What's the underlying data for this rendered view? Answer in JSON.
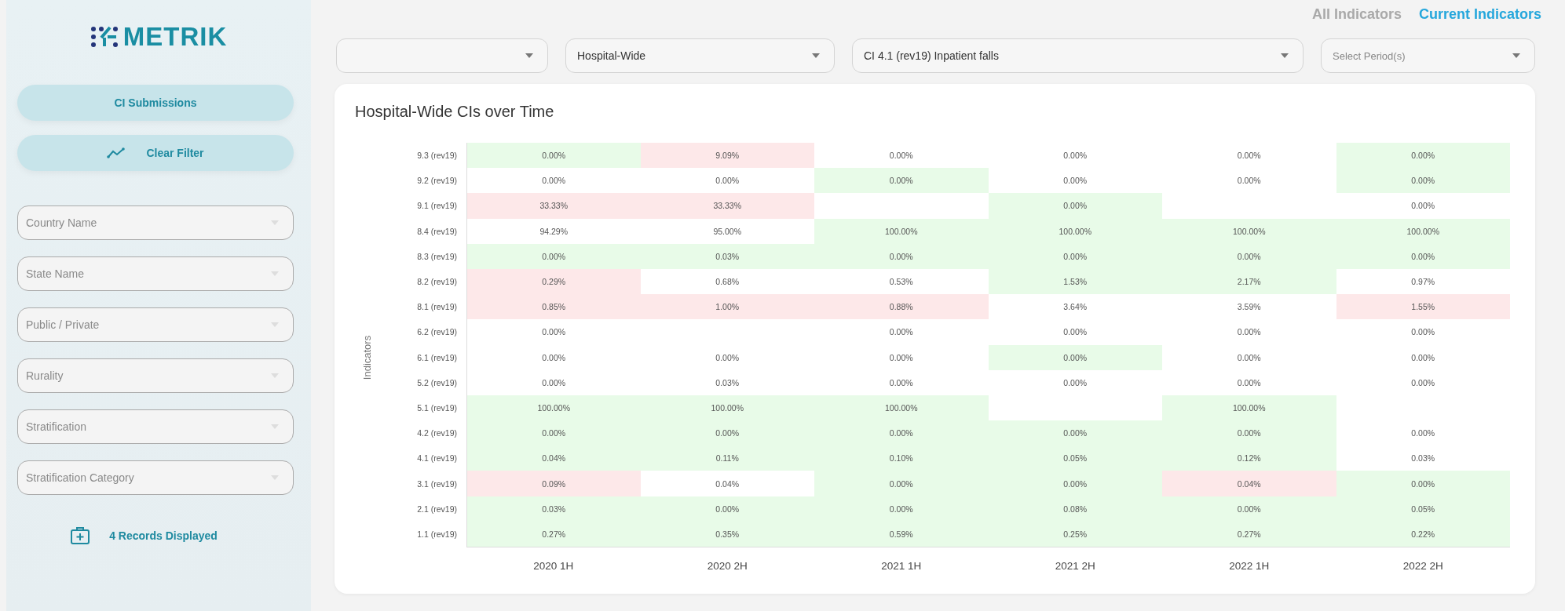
{
  "sidebar": {
    "logo": "METRIK",
    "buttons": [
      {
        "label": "CI Submissions",
        "kind": "plain"
      },
      {
        "label": "Clear Filter",
        "kind": "chart"
      }
    ],
    "filters": [
      {
        "placeholder": "Country Name"
      },
      {
        "placeholder": "State Name"
      },
      {
        "placeholder": "Public / Private"
      },
      {
        "placeholder": "Rurality"
      },
      {
        "placeholder": "Stratification"
      },
      {
        "placeholder": "Stratification Category"
      }
    ],
    "records": "4 Records Displayed"
  },
  "view_tabs": [
    {
      "label": "All Indicators",
      "selected": false
    },
    {
      "label": "Current Indicators",
      "selected": true
    }
  ],
  "dropdowns": [
    {
      "kind": "dropdown"
    },
    {
      "kind": "dropdown",
      "value": "Hospital-Wide"
    },
    {
      "kind": "dropdown",
      "value": "CI 4.1 (rev19) Inpatient falls"
    },
    {
      "kind": "dropdown",
      "placeholder": "Select Period(s)"
    }
  ],
  "heatmap": {
    "title": "Hospital-Wide CIs over Time",
    "ylabel": "Indicators",
    "rows": [
      {
        "label": "9.3 (rev19)",
        "cells": [
          {
            "text": "0.00%",
            "color": "#e8fbe8"
          },
          {
            "text": "9.09%",
            "color": "#fde8e9"
          },
          {
            "text": "0.00%",
            "color": "#ffffff"
          },
          {
            "text": "0.00%",
            "color": "#ffffff"
          },
          {
            "text": "0.00%",
            "color": "#ffffff"
          },
          {
            "text": "0.00%",
            "color": "#e8fbe8"
          }
        ]
      },
      {
        "label": "9.2 (rev19)",
        "cells": [
          {
            "text": "0.00%",
            "color": "#ffffff"
          },
          {
            "text": "0.00%",
            "color": "#ffffff"
          },
          {
            "text": "0.00%",
            "color": "#e8fbe8"
          },
          {
            "text": "0.00%",
            "color": "#ffffff"
          },
          {
            "text": "0.00%",
            "color": "#ffffff"
          },
          {
            "text": "0.00%",
            "color": "#e8fbe8"
          }
        ]
      },
      {
        "label": "9.1 (rev19)",
        "cells": [
          {
            "text": "33.33%",
            "color": "#fde8e9"
          },
          {
            "text": "33.33%",
            "color": "#fde8e9"
          },
          {},
          {
            "text": "0.00%",
            "color": "#e8fbe8"
          },
          {},
          {
            "text": "0.00%",
            "color": "#ffffff"
          }
        ]
      },
      {
        "label": "8.4 (rev19)",
        "cells": [
          {
            "text": "94.29%",
            "color": "#ffffff"
          },
          {
            "text": "95.00%",
            "color": "#ffffff"
          },
          {
            "text": "100.00%",
            "color": "#e8fbe8"
          },
          {
            "text": "100.00%",
            "color": "#e8fbe8"
          },
          {
            "text": "100.00%",
            "color": "#e8fbe8"
          },
          {
            "text": "100.00%",
            "color": "#e8fbe8"
          }
        ]
      },
      {
        "label": "8.3 (rev19)",
        "cells": [
          {
            "text": "0.00%",
            "color": "#e8fbe8"
          },
          {
            "text": "0.03%",
            "color": "#e8fbe8"
          },
          {
            "text": "0.00%",
            "color": "#e8fbe8"
          },
          {
            "text": "0.00%",
            "color": "#e8fbe8"
          },
          {
            "text": "0.00%",
            "color": "#e8fbe8"
          },
          {
            "text": "0.00%",
            "color": "#e8fbe8"
          }
        ]
      },
      {
        "label": "8.2 (rev19)",
        "cells": [
          {
            "text": "0.29%",
            "color": "#fde8e9"
          },
          {
            "text": "0.68%",
            "color": "#ffffff"
          },
          {
            "text": "0.53%",
            "color": "#ffffff"
          },
          {
            "text": "1.53%",
            "color": "#e8fbe8"
          },
          {
            "text": "2.17%",
            "color": "#e8fbe8"
          },
          {
            "text": "0.97%",
            "color": "#ffffff"
          }
        ]
      },
      {
        "label": "8.1 (rev19)",
        "cells": [
          {
            "text": "0.85%",
            "color": "#fde8e9"
          },
          {
            "text": "1.00%",
            "color": "#fde8e9"
          },
          {
            "text": "0.88%",
            "color": "#fde8e9"
          },
          {
            "text": "3.64%",
            "color": "#ffffff"
          },
          {
            "text": "3.59%",
            "color": "#ffffff"
          },
          {
            "text": "1.55%",
            "color": "#fde8e9"
          }
        ]
      },
      {
        "label": "6.2 (rev19)",
        "cells": [
          {
            "text": "0.00%",
            "color": "#ffffff"
          },
          {},
          {
            "text": "0.00%",
            "color": "#ffffff"
          },
          {
            "text": "0.00%",
            "color": "#ffffff"
          },
          {
            "text": "0.00%",
            "color": "#ffffff"
          },
          {
            "text": "0.00%",
            "color": "#ffffff"
          }
        ]
      },
      {
        "label": "6.1 (rev19)",
        "cells": [
          {
            "text": "0.00%",
            "color": "#ffffff"
          },
          {
            "text": "0.00%",
            "color": "#ffffff"
          },
          {
            "text": "0.00%",
            "color": "#ffffff"
          },
          {
            "text": "0.00%",
            "color": "#e8fbe8"
          },
          {
            "text": "0.00%",
            "color": "#ffffff"
          },
          {
            "text": "0.00%",
            "color": "#ffffff"
          }
        ]
      },
      {
        "label": "5.2 (rev19)",
        "cells": [
          {
            "text": "0.00%",
            "color": "#ffffff"
          },
          {
            "text": "0.03%",
            "color": "#ffffff"
          },
          {
            "text": "0.00%",
            "color": "#ffffff"
          },
          {
            "text": "0.00%",
            "color": "#ffffff"
          },
          {
            "text": "0.00%",
            "color": "#ffffff"
          },
          {
            "text": "0.00%",
            "color": "#ffffff"
          }
        ]
      },
      {
        "label": "5.1 (rev19)",
        "cells": [
          {
            "text": "100.00%",
            "color": "#e8fbe8"
          },
          {
            "text": "100.00%",
            "color": "#e8fbe8"
          },
          {
            "text": "100.00%",
            "color": "#e8fbe8"
          },
          {},
          {
            "text": "100.00%",
            "color": "#e8fbe8"
          },
          {}
        ]
      },
      {
        "label": "4.2 (rev19)",
        "cells": [
          {
            "text": "0.00%",
            "color": "#e8fbe8"
          },
          {
            "text": "0.00%",
            "color": "#e8fbe8"
          },
          {
            "text": "0.00%",
            "color": "#e8fbe8"
          },
          {
            "text": "0.00%",
            "color": "#e8fbe8"
          },
          {
            "text": "0.00%",
            "color": "#e8fbe8"
          },
          {
            "text": "0.00%",
            "color": "#ffffff"
          }
        ]
      },
      {
        "label": "4.1 (rev19)",
        "cells": [
          {
            "text": "0.04%",
            "color": "#e8fbe8"
          },
          {
            "text": "0.11%",
            "color": "#e8fbe8"
          },
          {
            "text": "0.10%",
            "color": "#e8fbe8"
          },
          {
            "text": "0.05%",
            "color": "#e8fbe8"
          },
          {
            "text": "0.12%",
            "color": "#e8fbe8"
          },
          {
            "text": "0.03%",
            "color": "#ffffff"
          }
        ]
      },
      {
        "label": "3.1 (rev19)",
        "cells": [
          {
            "text": "0.09%",
            "color": "#fde8e9"
          },
          {
            "text": "0.04%",
            "color": "#ffffff"
          },
          {
            "text": "0.00%",
            "color": "#e8fbe8"
          },
          {
            "text": "0.00%",
            "color": "#e8fbe8"
          },
          {
            "text": "0.04%",
            "color": "#fde8e9"
          },
          {
            "text": "0.00%",
            "color": "#e8fbe8"
          }
        ]
      },
      {
        "label": "2.1 (rev19)",
        "cells": [
          {
            "text": "0.03%",
            "color": "#e8fbe8"
          },
          {
            "text": "0.00%",
            "color": "#e8fbe8"
          },
          {
            "text": "0.00%",
            "color": "#e8fbe8"
          },
          {
            "text": "0.08%",
            "color": "#e8fbe8"
          },
          {
            "text": "0.00%",
            "color": "#e8fbe8"
          },
          {
            "text": "0.05%",
            "color": "#e8fbe8"
          }
        ]
      },
      {
        "label": "1.1 (rev19)",
        "cells": [
          {
            "text": "0.27%",
            "color": "#e8fbe8"
          },
          {
            "text": "0.35%",
            "color": "#e8fbe8"
          },
          {
            "text": "0.59%",
            "color": "#e8fbe8"
          },
          {
            "text": "0.25%",
            "color": "#e8fbe8"
          },
          {
            "text": "0.27%",
            "color": "#e8fbe8"
          },
          {
            "text": "0.22%",
            "color": "#e8fbe8"
          }
        ]
      }
    ],
    "x_axis_labels": [
      "2020 1H",
      "2020 2H",
      "2021 1H",
      "2021 2H",
      "2022 1H",
      "2022 2H"
    ]
  }
}
